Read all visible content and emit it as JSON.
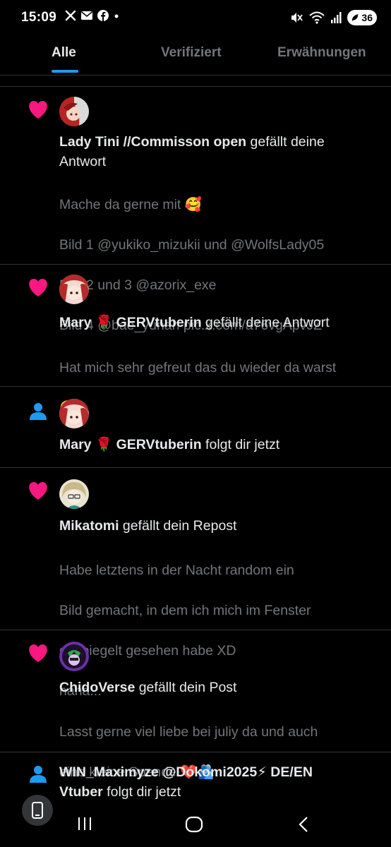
{
  "status_bar": {
    "time": "15:09",
    "battery": "36",
    "left_icons": [
      "x-logo-icon",
      "mail-icon",
      "facebook-icon",
      "dot-icon"
    ],
    "right_icons": [
      "mute-icon",
      "wifi-icon",
      "signal-icon",
      "battery-icon"
    ]
  },
  "tabs": [
    {
      "label": "Alle",
      "active": true
    },
    {
      "label": "Verifiziert",
      "active": false
    },
    {
      "label": "Erwähnungen",
      "active": false
    }
  ],
  "notifications": [
    {
      "type": "like",
      "actor": "Lady Tini //Commisson open",
      "action": " gefällt deine",
      "action_line2": "Antwort",
      "preview_lines": [
        "Mache da gerne mit 🥰",
        "Bild 1 @yukiko_mizukii und @WolfsLady05",
        "Bild 2 und 3 @azorix_exe",
        "Bild 4 @bae_yunah pic.x.com/a76vgApvJZ"
      ]
    },
    {
      "type": "like",
      "actor": "Mary 🌹 GERVtuberin",
      "action": " gefällt deine Antwort",
      "preview_lines": [
        "Hat mich sehr gefreut das du wieder da warst",
        "🥰"
      ]
    },
    {
      "type": "follow",
      "actor": "Mary 🌹 GERVtuberin",
      "action": " folgt dir jetzt"
    },
    {
      "type": "like",
      "actor": "Mikatomi",
      "action": " gefällt dein Repost",
      "preview_lines": [
        "Habe letztens in der Nacht random ein",
        "Bild gemacht, in dem ich mich im Fenster",
        "gespiegelt gesehen habe XD",
        "haha..."
      ]
    },
    {
      "type": "like",
      "actor": "ChidoVerse",
      "action": " gefällt dein Post",
      "preview_lines": [
        "Lasst gerne viel liebe bei juliy da und auch",
        "eine kleine Spende ❤️🫂"
      ]
    },
    {
      "type": "follow",
      "actor": "WIN_Maximyze @Dokomi2025⚡ DE/EN",
      "actor_line2": "Vtuber",
      "action": " folgt dir jetzt"
    }
  ],
  "colors": {
    "like": "#f91880",
    "follow": "#1d9bf0",
    "accent": "#1d9bf0",
    "muted_text": "#71767b"
  },
  "nav": [
    "recent-apps-icon",
    "home-icon",
    "back-icon"
  ]
}
